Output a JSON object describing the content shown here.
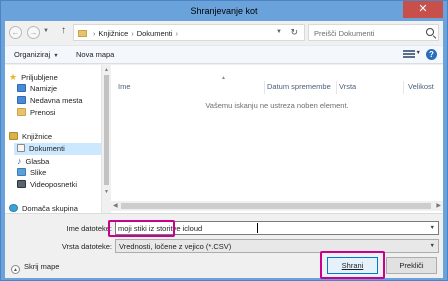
{
  "window": {
    "title": "Shranjevanje kot",
    "close_glyph": "✕"
  },
  "navigation": {
    "back_glyph": "←",
    "forward_glyph": "→",
    "up_glyph": "↑",
    "address": {
      "crumbs": [
        "Knjižnice",
        "Dokumenti"
      ]
    },
    "search_placeholder": "Preišči Dokumenti"
  },
  "toolbar": {
    "organize_label": "Organiziraj",
    "new_folder_label": "Nova mapa"
  },
  "sidebar": {
    "items": [
      {
        "label": "Priljubljene",
        "icon": "star-icon"
      },
      {
        "label": "Namizje",
        "icon": "desktop-folder-icon"
      },
      {
        "label": "Nedavna mesta",
        "icon": "recent-places-icon"
      },
      {
        "label": "Prenosi",
        "icon": "downloads-folder-icon"
      },
      {
        "label": "Knjižnice",
        "icon": "libraries-icon"
      },
      {
        "label": "Dokumenti",
        "icon": "documents-icon",
        "selected": true
      },
      {
        "label": "Glasba",
        "icon": "music-icon"
      },
      {
        "label": "Slike",
        "icon": "pictures-icon"
      },
      {
        "label": "Videoposnetki",
        "icon": "videos-icon"
      },
      {
        "label": "Domača skupina",
        "icon": "homegroup-icon"
      }
    ]
  },
  "filelist": {
    "columns": [
      "Ime",
      "Datum spremembe",
      "Vrsta",
      "Velikost"
    ],
    "empty_message": "Vašemu iskanju ne ustreza noben element."
  },
  "form": {
    "filename_label": "Ime datoteke:",
    "filename_value": "moji stiki iz storitve icloud",
    "filetype_label": "Vrsta datoteke:",
    "filetype_value": "Vrednosti, ločene z vejico (*.CSV)"
  },
  "footer": {
    "hide_folders_label": "Skrij mape",
    "save_label": "Shrani",
    "cancel_label": "Prekliči"
  },
  "colors": {
    "highlight": "#c8008c",
    "titlebar": "#6aa2dc",
    "selection": "#cce8ff"
  }
}
